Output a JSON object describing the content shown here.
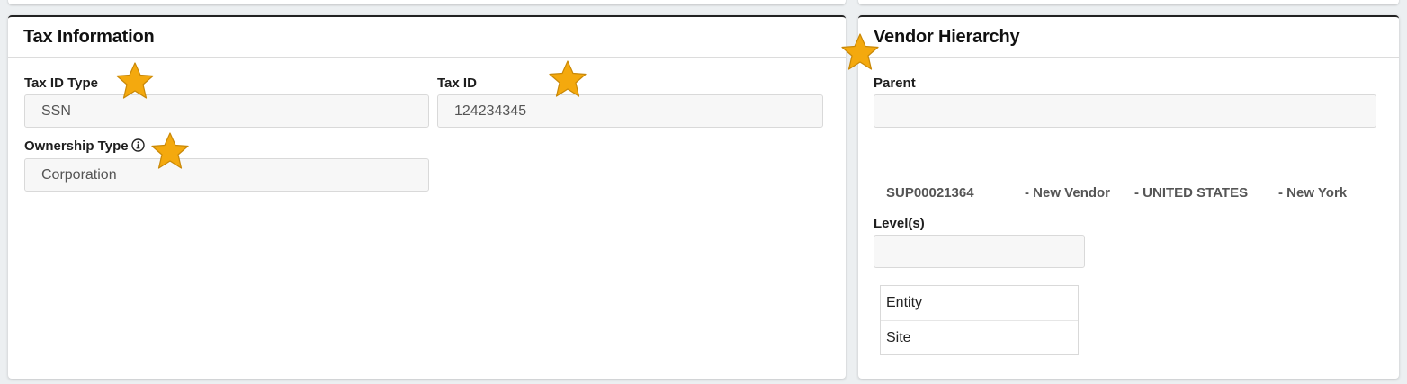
{
  "tax_info": {
    "title": "Tax Information",
    "tax_id_type_label": "Tax ID Type",
    "tax_id_type_value": "SSN",
    "tax_id_label": "Tax ID",
    "tax_id_value": "124234345",
    "ownership_type_label": "Ownership Type",
    "ownership_type_value": "Corporation"
  },
  "vendor_hierarchy": {
    "title": "Vendor Hierarchy",
    "parent_label": "Parent",
    "parent_value": "",
    "vendor_id": "SUP00021364",
    "vendor_name": "- New Vendor",
    "country": "- UNITED STATES",
    "state": "- New York",
    "levels_label": "Level(s)",
    "levels_value": "",
    "level_options": [
      "Entity",
      "Site"
    ]
  },
  "colors": {
    "star": "#f4a90e",
    "card_border": "#222222",
    "background": "#eceff1"
  },
  "icons": [
    "info-icon",
    "star-icon"
  ]
}
